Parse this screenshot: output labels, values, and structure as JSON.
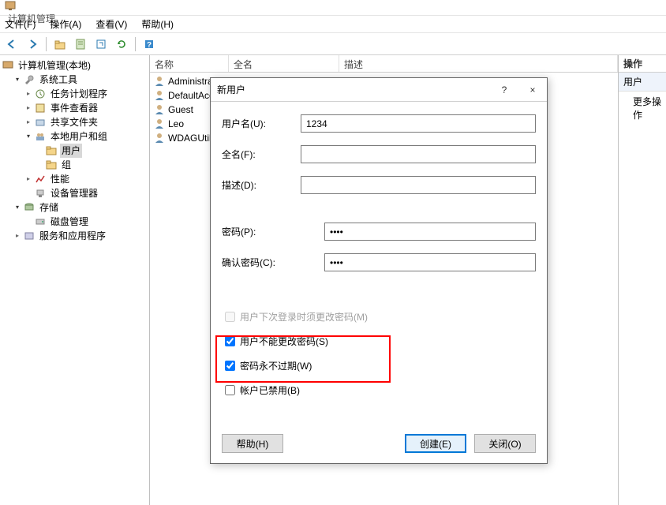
{
  "window": {
    "title": "计算机管理"
  },
  "menu": {
    "file": "文件(F)",
    "action": "操作(A)",
    "view": "查看(V)",
    "help": "帮助(H)"
  },
  "tree": {
    "root": "计算机管理(本地)",
    "system_tools": "系统工具",
    "task_scheduler": "任务计划程序",
    "event_viewer": "事件查看器",
    "shared_folders": "共享文件夹",
    "local_users_groups": "本地用户和组",
    "users": "用户",
    "groups": "组",
    "performance": "性能",
    "device_manager": "设备管理器",
    "storage": "存储",
    "disk_management": "磁盘管理",
    "services_apps": "服务和应用程序"
  },
  "list": {
    "headers": {
      "name": "名称",
      "fullname": "全名",
      "description": "描述"
    },
    "items": [
      {
        "name": "Administrator"
      },
      {
        "name": "DefaultAccount"
      },
      {
        "name": "Guest"
      },
      {
        "name": "Leo"
      },
      {
        "name": "WDAGUtilityAccount"
      }
    ]
  },
  "actions": {
    "header": "操作",
    "sub": "用户",
    "more": "更多操作"
  },
  "dialog": {
    "title": "新用户",
    "username_label": "用户名(U):",
    "username_value": "1234",
    "fullname_label": "全名(F):",
    "description_label": "描述(D):",
    "password_label": "密码(P):",
    "password_value": "••••",
    "confirm_label": "确认密码(C):",
    "confirm_value": "••••",
    "must_change": "用户下次登录时须更改密码(M)",
    "cannot_change": "用户不能更改密码(S)",
    "never_expires": "密码永不过期(W)",
    "disabled": "帐户已禁用(B)",
    "help": "帮助(H)",
    "create": "创建(E)",
    "close": "关闭(O)",
    "help_btn": "?",
    "close_btn": "×"
  }
}
